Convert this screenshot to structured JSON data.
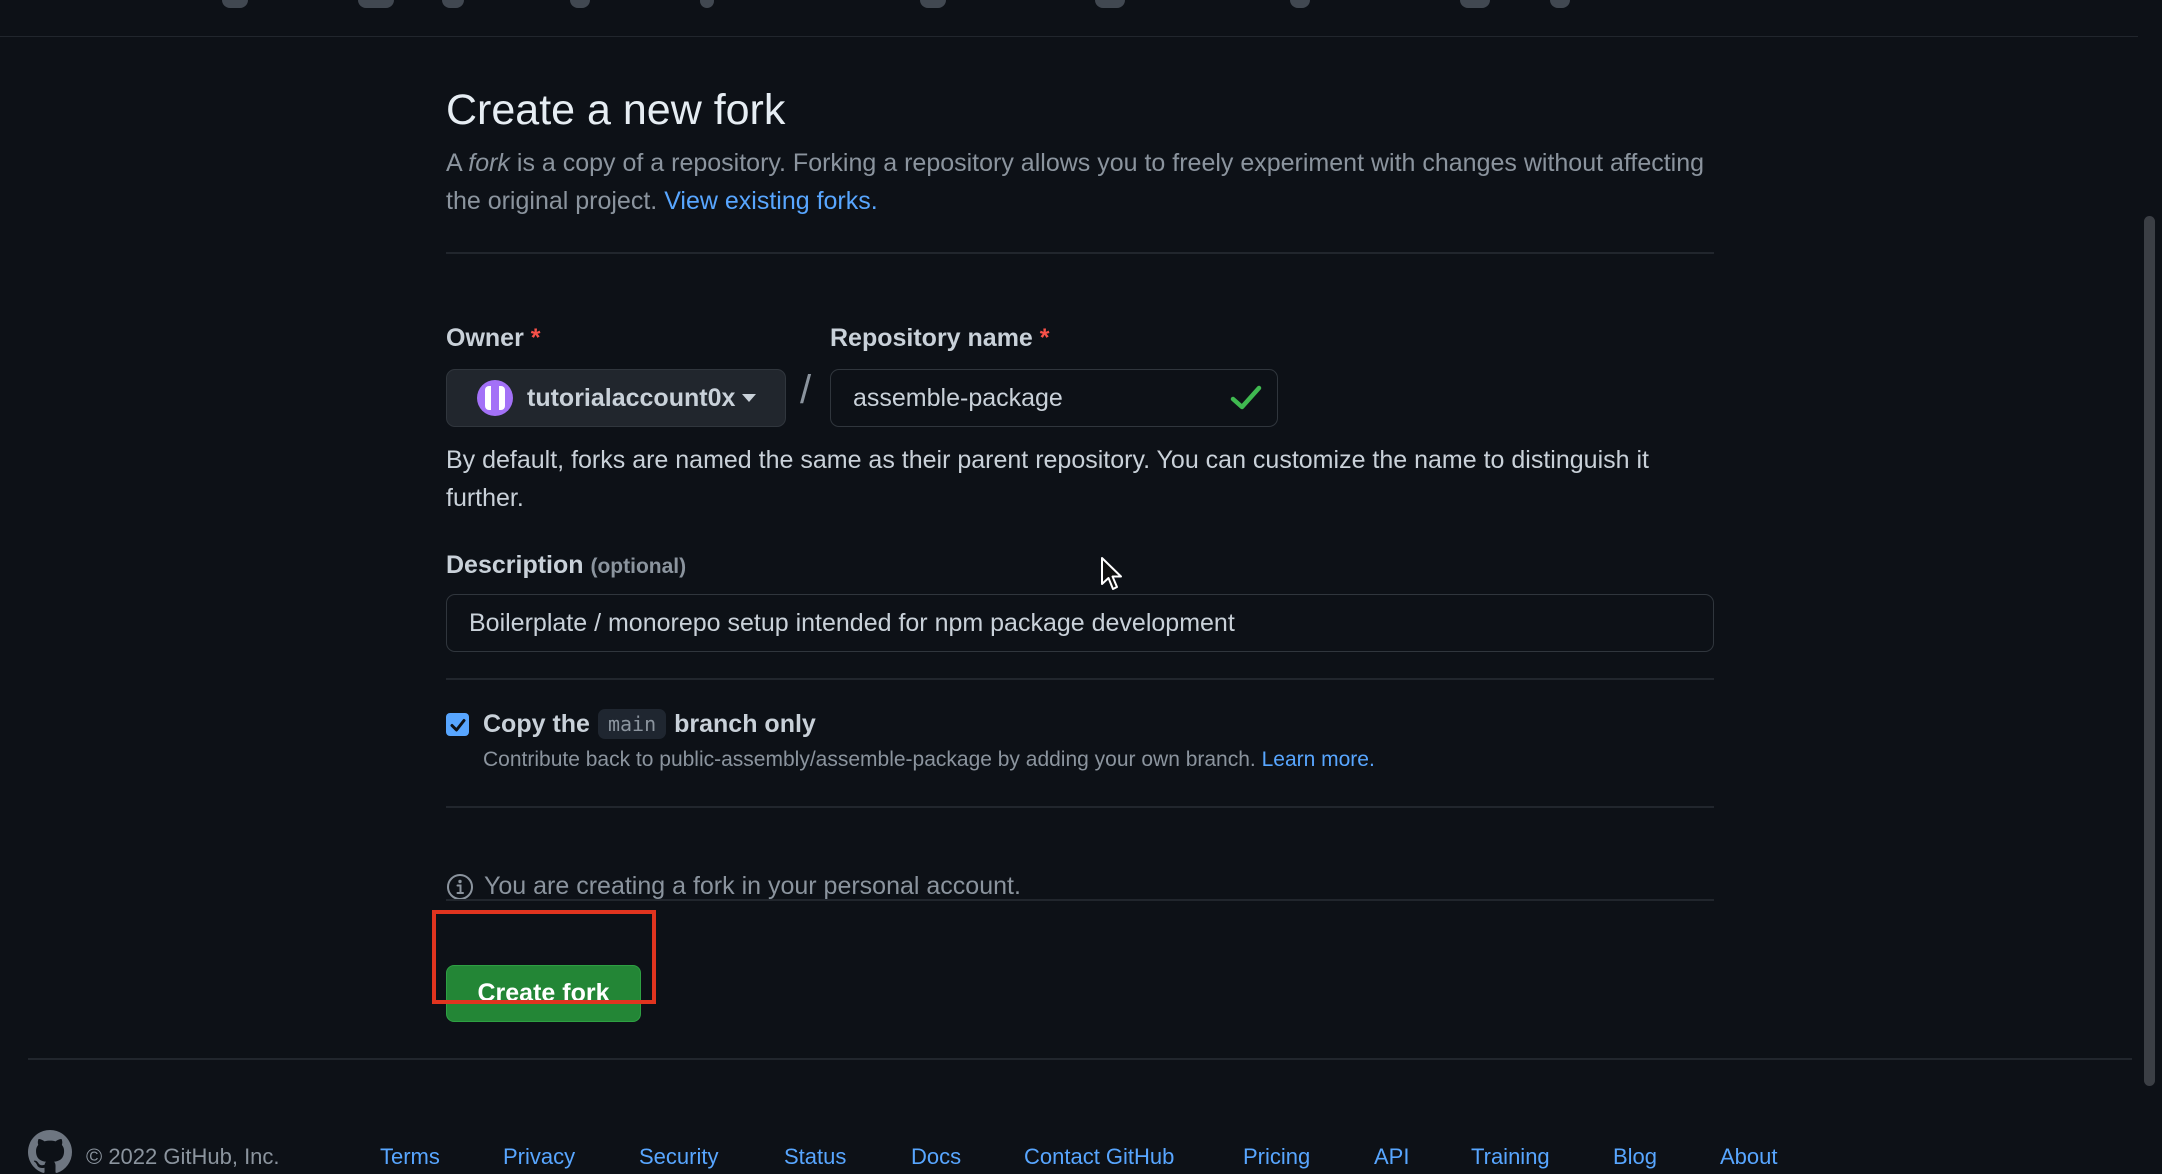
{
  "page": {
    "title": "Create a new fork",
    "intro_prefix": "A ",
    "intro_em": "fork",
    "intro_rest": " is a copy of a repository. Forking a repository allows you to freely experiment with changes without affecting the original project. ",
    "intro_link": "View existing forks."
  },
  "owner": {
    "label": "Owner",
    "required_mark": "*",
    "value": "tutorialaccount0x"
  },
  "repo": {
    "label": "Repository name",
    "required_mark": "*",
    "separator": "/",
    "value": "assemble-package",
    "hint": "By default, forks are named the same as their parent repository. You can customize the name to distinguish it further."
  },
  "description": {
    "label": "Description",
    "optional": "(optional)",
    "value": "Boilerplate / monorepo setup intended for npm package development"
  },
  "copy_branch": {
    "checked": true,
    "label_prefix": "Copy the",
    "branch": "main",
    "label_suffix": "branch only",
    "sub_text": "Contribute back to public-assembly/assemble-package by adding your own branch. ",
    "sub_link": "Learn more."
  },
  "info": {
    "text": "You are creating a fork in your personal account."
  },
  "create_button": {
    "label": "Create fork"
  },
  "footer": {
    "copyright": "© 2022 GitHub, Inc.",
    "links": [
      "Terms",
      "Privacy",
      "Security",
      "Status",
      "Docs",
      "Contact GitHub",
      "Pricing",
      "API",
      "Training",
      "Blog",
      "About"
    ]
  },
  "colors": {
    "background": "#0d1117",
    "link": "#58a6ff",
    "primary_button": "#238636",
    "required": "#f85149",
    "highlight": "#e0341f",
    "success_check": "#3fb950"
  }
}
